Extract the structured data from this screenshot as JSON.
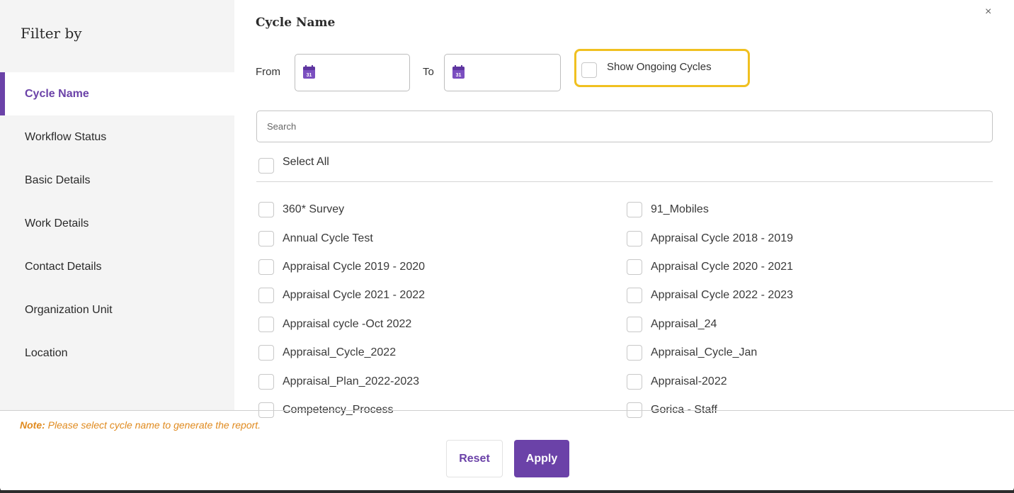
{
  "sidebar": {
    "title": "Filter by",
    "items": [
      {
        "label": "Cycle Name",
        "active": true
      },
      {
        "label": "Workflow Status"
      },
      {
        "label": "Basic Details"
      },
      {
        "label": "Work Details"
      },
      {
        "label": "Contact Details"
      },
      {
        "label": "Organization Unit"
      },
      {
        "label": "Location"
      }
    ]
  },
  "close_label": "×",
  "main": {
    "title": "Cycle Name",
    "from_label": "From",
    "to_label": "To",
    "calendar_day": "31",
    "show_ongoing_label": "Show Ongoing Cycles",
    "search_placeholder": "Search",
    "select_all_label": "Select All",
    "options_left": [
      "360* Survey",
      "Annual Cycle Test",
      "Appraisal Cycle 2019 - 2020",
      "Appraisal Cycle 2021 - 2022",
      "Appraisal cycle -Oct 2022",
      "Appraisal_Cycle_2022",
      "Appraisal_Plan_2022-2023",
      "Competency_Process"
    ],
    "options_right": [
      "91_Mobiles",
      "Appraisal Cycle 2018 - 2019",
      "Appraisal Cycle 2020 - 2021",
      "Appraisal Cycle 2022 - 2023",
      "Appraisal_24",
      "Appraisal_Cycle_Jan",
      "Appraisal-2022",
      "Gorica - Staff"
    ]
  },
  "footer": {
    "note_prefix": "Note:",
    "note_text": " Please select cycle name to generate the report.",
    "reset_label": "Reset",
    "apply_label": "Apply"
  },
  "colors": {
    "accent": "#6b42a8",
    "highlight": "#f0c020",
    "note": "#e08a1e"
  }
}
